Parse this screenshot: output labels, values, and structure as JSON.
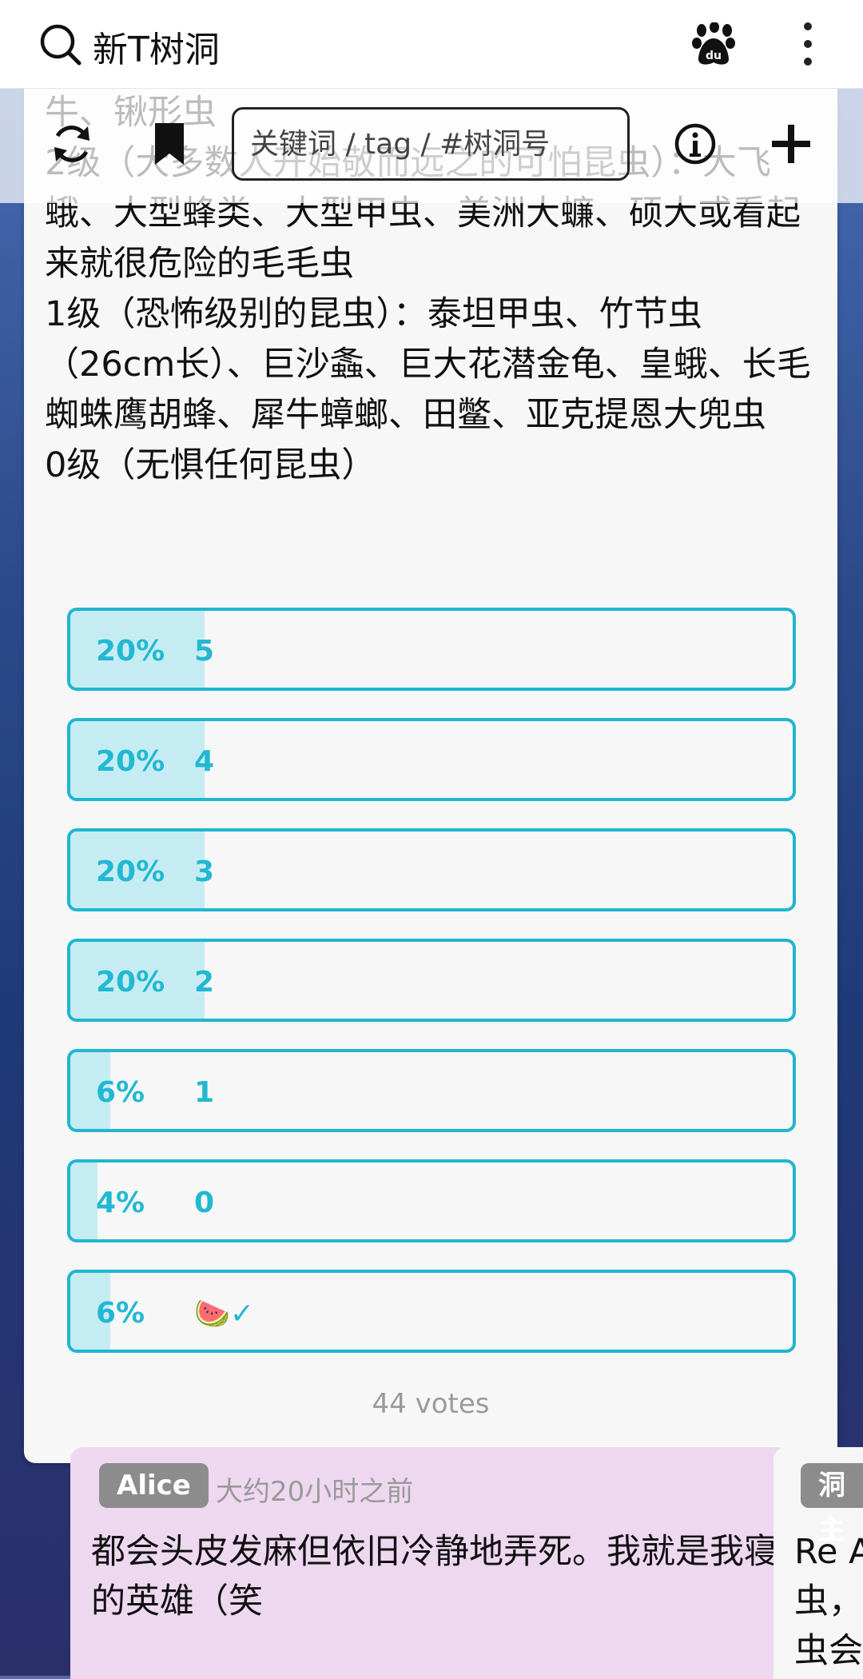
{
  "appbar": {
    "title": "新T树洞",
    "icons": [
      "search-icon",
      "paw-icon",
      "more-vertical-icon"
    ]
  },
  "toolbar": {
    "search_placeholder": "关键词 / tag / #树洞号",
    "icons": [
      "refresh-icon",
      "bookmark-icon",
      "info-icon",
      "plus-icon"
    ]
  },
  "post": {
    "text": "牛、锹形虫\n2级（大多数人开始敬而远之的可怕昆虫）：大飞蛾、大型蜂类、大型甲虫、美洲大蠊、硕大或看起来就很危险的毛毛虫\n1级（恐怖级别的昆虫）：泰坦甲虫、竹节虫（26cm长）、巨沙螽、巨大花潜金龟、皇蛾、长毛蜘蛛鹰胡蜂、犀牛蟑螂、田鳖、亚克提恩大兜虫\n0级（无惧任何昆虫）"
  },
  "poll": {
    "accent_color": "#1fb6cf",
    "fill_color": "#c6ecf3",
    "options": [
      {
        "percent": "20%",
        "fraction": 0.2,
        "label": "5"
      },
      {
        "percent": "20%",
        "fraction": 0.2,
        "label": "4"
      },
      {
        "percent": "20%",
        "fraction": 0.2,
        "label": "3"
      },
      {
        "percent": "20%",
        "fraction": 0.2,
        "label": "2"
      },
      {
        "percent": "6%",
        "fraction": 0.06,
        "label": "1"
      },
      {
        "percent": "4%",
        "fraction": 0.04,
        "label": "0"
      },
      {
        "percent": "6%",
        "fraction": 0.06,
        "label": "🍉✓"
      }
    ],
    "votes": "44 votes"
  },
  "replies": [
    {
      "author": "Alice",
      "time": "大约20小时之前",
      "text": "都会头皮发麻但依旧冷静地弄死。我就是我寝的英雄（笑"
    },
    {
      "author": "洞主",
      "time": "",
      "text": "Re A\n虫，\n虫会"
    }
  ]
}
